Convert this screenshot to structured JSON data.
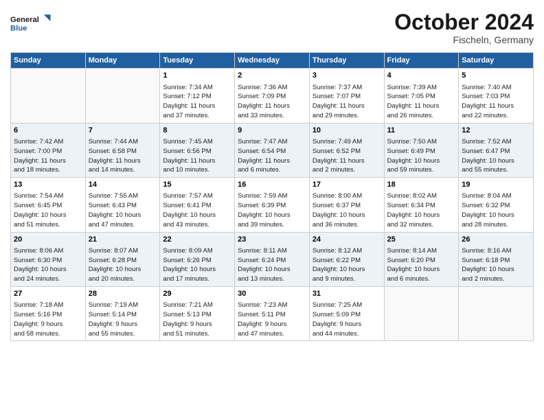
{
  "header": {
    "logo_line1": "General",
    "logo_line2": "Blue",
    "month": "October 2024",
    "location": "Fischeln, Germany"
  },
  "weekdays": [
    "Sunday",
    "Monday",
    "Tuesday",
    "Wednesday",
    "Thursday",
    "Friday",
    "Saturday"
  ],
  "weeks": [
    {
      "days": [
        {
          "num": "",
          "info": ""
        },
        {
          "num": "",
          "info": ""
        },
        {
          "num": "1",
          "info": "Sunrise: 7:34 AM\nSunset: 7:12 PM\nDaylight: 11 hours\nand 37 minutes."
        },
        {
          "num": "2",
          "info": "Sunrise: 7:36 AM\nSunset: 7:09 PM\nDaylight: 11 hours\nand 33 minutes."
        },
        {
          "num": "3",
          "info": "Sunrise: 7:37 AM\nSunset: 7:07 PM\nDaylight: 11 hours\nand 29 minutes."
        },
        {
          "num": "4",
          "info": "Sunrise: 7:39 AM\nSunset: 7:05 PM\nDaylight: 11 hours\nand 26 minutes."
        },
        {
          "num": "5",
          "info": "Sunrise: 7:40 AM\nSunset: 7:03 PM\nDaylight: 11 hours\nand 22 minutes."
        }
      ]
    },
    {
      "days": [
        {
          "num": "6",
          "info": "Sunrise: 7:42 AM\nSunset: 7:00 PM\nDaylight: 11 hours\nand 18 minutes."
        },
        {
          "num": "7",
          "info": "Sunrise: 7:44 AM\nSunset: 6:58 PM\nDaylight: 11 hours\nand 14 minutes."
        },
        {
          "num": "8",
          "info": "Sunrise: 7:45 AM\nSunset: 6:56 PM\nDaylight: 11 hours\nand 10 minutes."
        },
        {
          "num": "9",
          "info": "Sunrise: 7:47 AM\nSunset: 6:54 PM\nDaylight: 11 hours\nand 6 minutes."
        },
        {
          "num": "10",
          "info": "Sunrise: 7:49 AM\nSunset: 6:52 PM\nDaylight: 11 hours\nand 2 minutes."
        },
        {
          "num": "11",
          "info": "Sunrise: 7:50 AM\nSunset: 6:49 PM\nDaylight: 10 hours\nand 59 minutes."
        },
        {
          "num": "12",
          "info": "Sunrise: 7:52 AM\nSunset: 6:47 PM\nDaylight: 10 hours\nand 55 minutes."
        }
      ]
    },
    {
      "days": [
        {
          "num": "13",
          "info": "Sunrise: 7:54 AM\nSunset: 6:45 PM\nDaylight: 10 hours\nand 51 minutes."
        },
        {
          "num": "14",
          "info": "Sunrise: 7:55 AM\nSunset: 6:43 PM\nDaylight: 10 hours\nand 47 minutes."
        },
        {
          "num": "15",
          "info": "Sunrise: 7:57 AM\nSunset: 6:41 PM\nDaylight: 10 hours\nand 43 minutes."
        },
        {
          "num": "16",
          "info": "Sunrise: 7:59 AM\nSunset: 6:39 PM\nDaylight: 10 hours\nand 39 minutes."
        },
        {
          "num": "17",
          "info": "Sunrise: 8:00 AM\nSunset: 6:37 PM\nDaylight: 10 hours\nand 36 minutes."
        },
        {
          "num": "18",
          "info": "Sunrise: 8:02 AM\nSunset: 6:34 PM\nDaylight: 10 hours\nand 32 minutes."
        },
        {
          "num": "19",
          "info": "Sunrise: 8:04 AM\nSunset: 6:32 PM\nDaylight: 10 hours\nand 28 minutes."
        }
      ]
    },
    {
      "days": [
        {
          "num": "20",
          "info": "Sunrise: 8:06 AM\nSunset: 6:30 PM\nDaylight: 10 hours\nand 24 minutes."
        },
        {
          "num": "21",
          "info": "Sunrise: 8:07 AM\nSunset: 6:28 PM\nDaylight: 10 hours\nand 20 minutes."
        },
        {
          "num": "22",
          "info": "Sunrise: 8:09 AM\nSunset: 6:26 PM\nDaylight: 10 hours\nand 17 minutes."
        },
        {
          "num": "23",
          "info": "Sunrise: 8:11 AM\nSunset: 6:24 PM\nDaylight: 10 hours\nand 13 minutes."
        },
        {
          "num": "24",
          "info": "Sunrise: 8:12 AM\nSunset: 6:22 PM\nDaylight: 10 hours\nand 9 minutes."
        },
        {
          "num": "25",
          "info": "Sunrise: 8:14 AM\nSunset: 6:20 PM\nDaylight: 10 hours\nand 6 minutes."
        },
        {
          "num": "26",
          "info": "Sunrise: 8:16 AM\nSunset: 6:18 PM\nDaylight: 10 hours\nand 2 minutes."
        }
      ]
    },
    {
      "days": [
        {
          "num": "27",
          "info": "Sunrise: 7:18 AM\nSunset: 5:16 PM\nDaylight: 9 hours\nand 58 minutes."
        },
        {
          "num": "28",
          "info": "Sunrise: 7:19 AM\nSunset: 5:14 PM\nDaylight: 9 hours\nand 55 minutes."
        },
        {
          "num": "29",
          "info": "Sunrise: 7:21 AM\nSunset: 5:13 PM\nDaylight: 9 hours\nand 51 minutes."
        },
        {
          "num": "30",
          "info": "Sunrise: 7:23 AM\nSunset: 5:11 PM\nDaylight: 9 hours\nand 47 minutes."
        },
        {
          "num": "31",
          "info": "Sunrise: 7:25 AM\nSunset: 5:09 PM\nDaylight: 9 hours\nand 44 minutes."
        },
        {
          "num": "",
          "info": ""
        },
        {
          "num": "",
          "info": ""
        }
      ]
    }
  ]
}
